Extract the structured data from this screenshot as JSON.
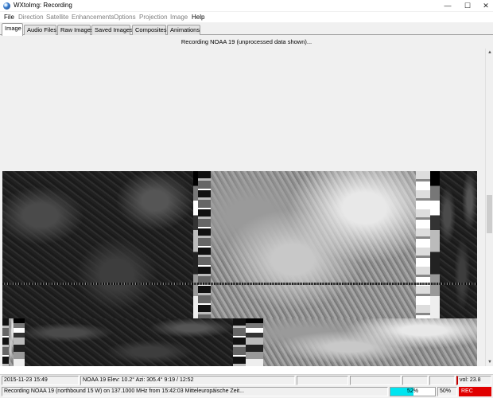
{
  "window": {
    "title": "WXtoImg: Recording",
    "controls": {
      "minimize": "—",
      "maximize": "☐",
      "close": "✕"
    }
  },
  "menu": [
    {
      "label": "File",
      "enabled": true
    },
    {
      "label": "Direction",
      "enabled": false
    },
    {
      "label": "Satellite",
      "enabled": false
    },
    {
      "label": "Enhancements",
      "enabled": false
    },
    {
      "label": "Options",
      "enabled": false
    },
    {
      "label": "Projection",
      "enabled": false
    },
    {
      "label": "Image",
      "enabled": false
    },
    {
      "label": "Help",
      "enabled": true
    }
  ],
  "tabs": [
    {
      "label": "Image",
      "active": true
    },
    {
      "label": "Audio Files",
      "active": false
    },
    {
      "label": "Raw Images",
      "active": false
    },
    {
      "label": "Saved Images",
      "active": false
    },
    {
      "label": "Composites",
      "active": false
    },
    {
      "label": "Animations",
      "active": false
    }
  ],
  "status_message": "Recording NOAA 19 (unprocessed data shown)...",
  "statusbar": {
    "datetime": "2015-11-23  15:49",
    "satellite_info": "NOAA 19   Elev: 10.2°   Azi: 305.4°   9:19 / 12:52",
    "volume": "vol: 23.8",
    "recording_line": "Recording NOAA 19 (northbound 15 W) on 137.1000 MHz from 15:42:03 Mitteleuropäische Zeit...",
    "progress_label": "52%",
    "progress_value": 52,
    "signal_label": "50%",
    "rec_label": "REC"
  },
  "colors": {
    "progress_fill": "#00e5f0",
    "rec_background": "#e00000",
    "volume_marker": "#c00000"
  }
}
